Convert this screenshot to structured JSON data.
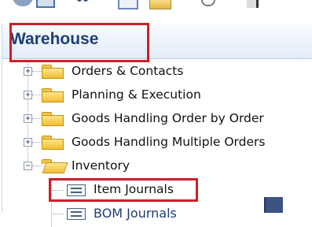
{
  "toolbar": {
    "icons": [
      "toolbar-icon-1",
      "toolbar-icon-2",
      "toolbar-icon-3",
      "toolbar-icon-4",
      "toolbar-icon-5",
      "toolbar-icon-6",
      "toolbar-icon-7"
    ]
  },
  "panel": {
    "title": "Warehouse",
    "tree": [
      {
        "label": "Orders & Contacts",
        "expander": "+"
      },
      {
        "label": "Planning & Execution",
        "expander": "+"
      },
      {
        "label": "Goods Handling Order by Order",
        "expander": "+"
      },
      {
        "label": "Goods Handling Multiple Orders",
        "expander": "+"
      },
      {
        "label": "Inventory",
        "expander": "−",
        "open": true
      }
    ],
    "children": [
      {
        "label": "Item Journals",
        "highlighted": true
      },
      {
        "label": "BOM Journals",
        "cut_off": true
      }
    ]
  },
  "colors": {
    "highlight": "#cf1e2b",
    "title": "#1f3f76",
    "folder": "#f2bd35"
  }
}
